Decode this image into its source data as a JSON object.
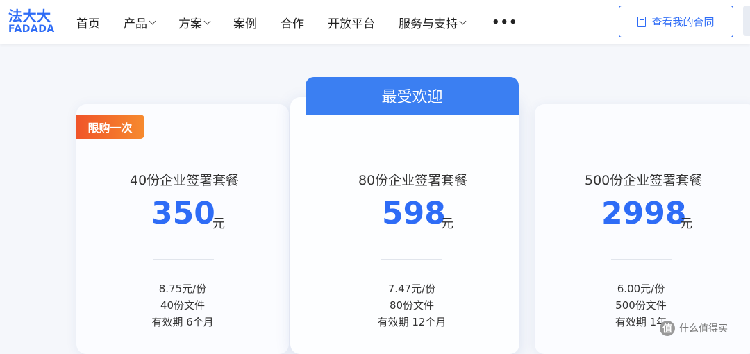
{
  "header": {
    "logo": {
      "top": "法大大",
      "bottom": "FADADA"
    },
    "nav": [
      {
        "label": "首页",
        "dropdown": false
      },
      {
        "label": "产品",
        "dropdown": true
      },
      {
        "label": "方案",
        "dropdown": true
      },
      {
        "label": "案例",
        "dropdown": false
      },
      {
        "label": "合作",
        "dropdown": false
      },
      {
        "label": "开放平台",
        "dropdown": false
      },
      {
        "label": "服务与支持",
        "dropdown": true
      }
    ],
    "more": "•••",
    "contract_button": "查看我的合同"
  },
  "badges": {
    "popular": "最受欢迎",
    "limited": "限购一次"
  },
  "plans": [
    {
      "name": "40份企业签署套餐",
      "price": "350",
      "unit": "元",
      "per": "8.75元/份",
      "count": "40份文件",
      "validity": "有效期 6个月"
    },
    {
      "name": "80份企业签署套餐",
      "price": "598",
      "unit": "元",
      "per": "7.47元/份",
      "count": "80份文件",
      "validity": "有效期 12个月"
    },
    {
      "name": "500份企业签署套餐",
      "price": "2998",
      "unit": "元",
      "per": "6.00元/份",
      "count": "500份文件",
      "validity": "有效期 1年"
    }
  ],
  "watermark": {
    "icon": "值",
    "text": "什么值得买"
  },
  "colors": {
    "brand": "#2e6cf6",
    "popular_tab": "#3b7ff2",
    "limited_badge": "#f0542a"
  }
}
